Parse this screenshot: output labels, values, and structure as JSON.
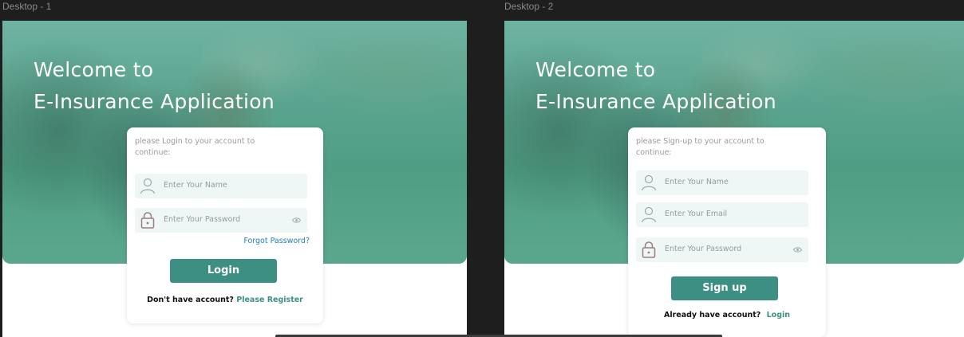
{
  "frames": [
    {
      "label": "Desktop - 1",
      "hero": {
        "line1": "Welcome to",
        "line2": "E-Insurance Application"
      },
      "card": {
        "prompt": "please Login to your account to continue:",
        "name_placeholder": "Enter Your Name",
        "password_placeholder": "Enter  Your Password",
        "forgot_link": "Forgot Password?",
        "button": "Login",
        "footer_text": "Don't have account?",
        "footer_link": "Please Register"
      }
    },
    {
      "label": "Desktop - 2",
      "hero": {
        "line1": "Welcome to",
        "line2": "E-Insurance Application"
      },
      "card": {
        "prompt": "please Sign-up to your account to continue:",
        "name_placeholder": "Enter Your Name",
        "email_placeholder": "Enter Your Email",
        "password_placeholder": "Enter  Your Password",
        "button": "Sign up",
        "footer_text": "Already have account?",
        "footer_link": "Login"
      }
    }
  ],
  "colors": {
    "accent": "#3d8f84",
    "link_blue": "#1f7fc6",
    "field_bg": "#eef6f6",
    "hero_tint": "#5aa48f",
    "canvas_bg": "#1e1e1e"
  },
  "icons": [
    "user-icon",
    "padlock-icon",
    "eye-icon"
  ]
}
